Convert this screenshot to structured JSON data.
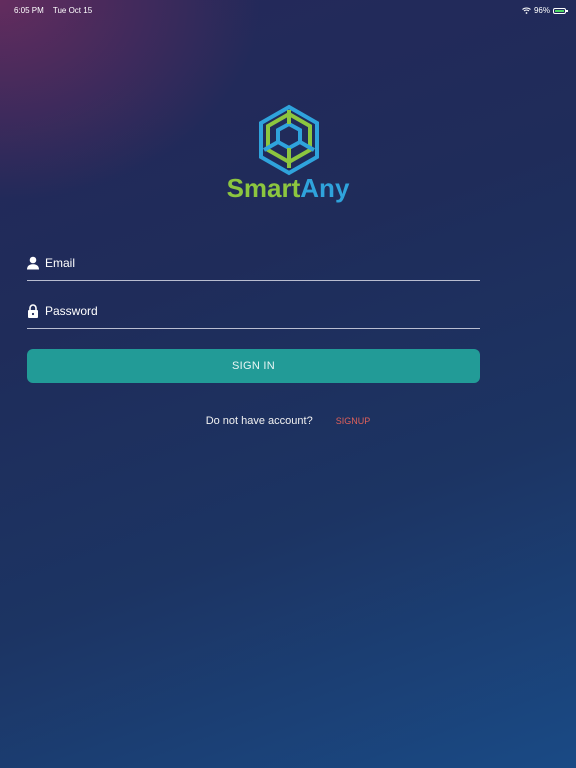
{
  "status_bar": {
    "time": "6:05 PM",
    "date": "Tue Oct 15",
    "battery_percent": "96%",
    "battery_level": 0.96,
    "icons": [
      "wifi-icon",
      "battery-icon"
    ]
  },
  "brand": {
    "name_part1": "Smart",
    "name_part2": "Any",
    "colors": {
      "green": "#8cc63f",
      "blue": "#2fa3dc"
    }
  },
  "form": {
    "email_placeholder": "Email",
    "email_value": "",
    "password_placeholder": "Password",
    "password_value": "",
    "signin_label": "SIGN IN"
  },
  "signup": {
    "prompt": "Do not have account?",
    "link_label": "SIGNUP"
  },
  "colors": {
    "accent": "#229b97",
    "link": "#e0615a",
    "background_top": "#25285a",
    "background_bottom": "#1a4a85"
  }
}
